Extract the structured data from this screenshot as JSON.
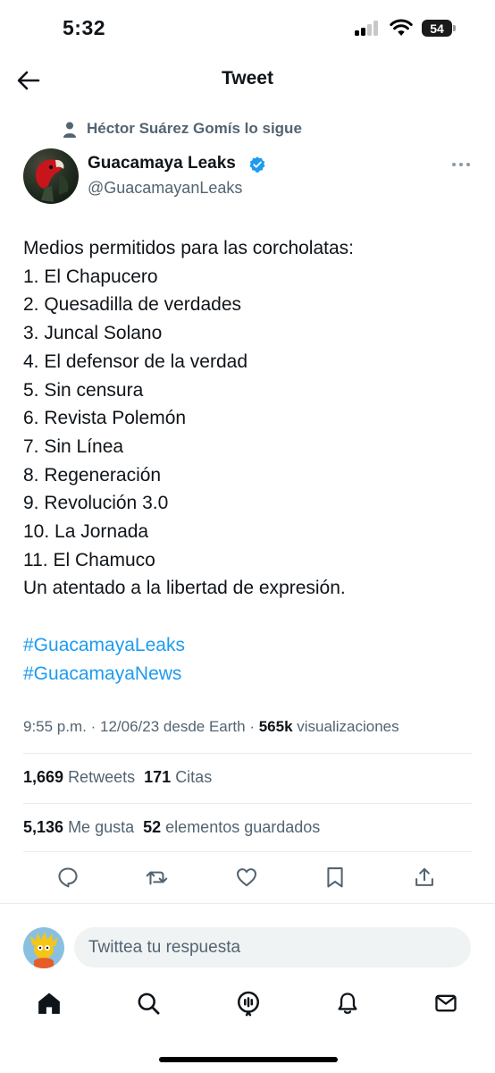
{
  "status_bar": {
    "time": "5:32",
    "battery": "54"
  },
  "header": {
    "title": "Tweet"
  },
  "social_context": {
    "text": "Héctor Suárez Gomís lo sigue"
  },
  "author": {
    "display_name": "Guacamaya Leaks",
    "handle": "@GuacamayanLeaks",
    "verified": true
  },
  "tweet": {
    "lines": [
      "Medios permitidos para las corcholatas:",
      "1. El Chapucero",
      "2. Quesadilla de verdades",
      "3. Juncal Solano",
      "4. El defensor de la verdad",
      "5. Sin censura",
      "6. Revista Polemón",
      "7. Sin Línea",
      "8. Regeneración",
      "9. Revolución 3.0",
      "10. La Jornada",
      "11. El Chamuco",
      "Un atentado a la libertad de expresión."
    ],
    "hashtags": [
      "#GuacamayaLeaks",
      "#GuacamayaNews"
    ]
  },
  "meta": {
    "time": "9:55 p.m.",
    "date": "12/06/23",
    "source": "desde Earth",
    "views_count": "565k",
    "views_label": "visualizaciones"
  },
  "stats": {
    "retweets_count": "1,669",
    "retweets_label": "Retweets",
    "quotes_count": "171",
    "quotes_label": "Citas",
    "likes_count": "5,136",
    "likes_label": "Me gusta",
    "bookmarks_count": "52",
    "bookmarks_label": "elementos guardados"
  },
  "actions": [
    "reply-icon",
    "retweet-icon",
    "like-icon",
    "bookmark-icon",
    "share-icon"
  ],
  "reply": {
    "placeholder": "Twittea tu respuesta"
  },
  "tab_bar": [
    "home-icon",
    "search-icon",
    "spaces-icon",
    "notifications-icon",
    "messages-icon"
  ],
  "colors": {
    "accent": "#1d9bf0",
    "text_secondary": "#536471",
    "text_primary": "#0f1419"
  }
}
